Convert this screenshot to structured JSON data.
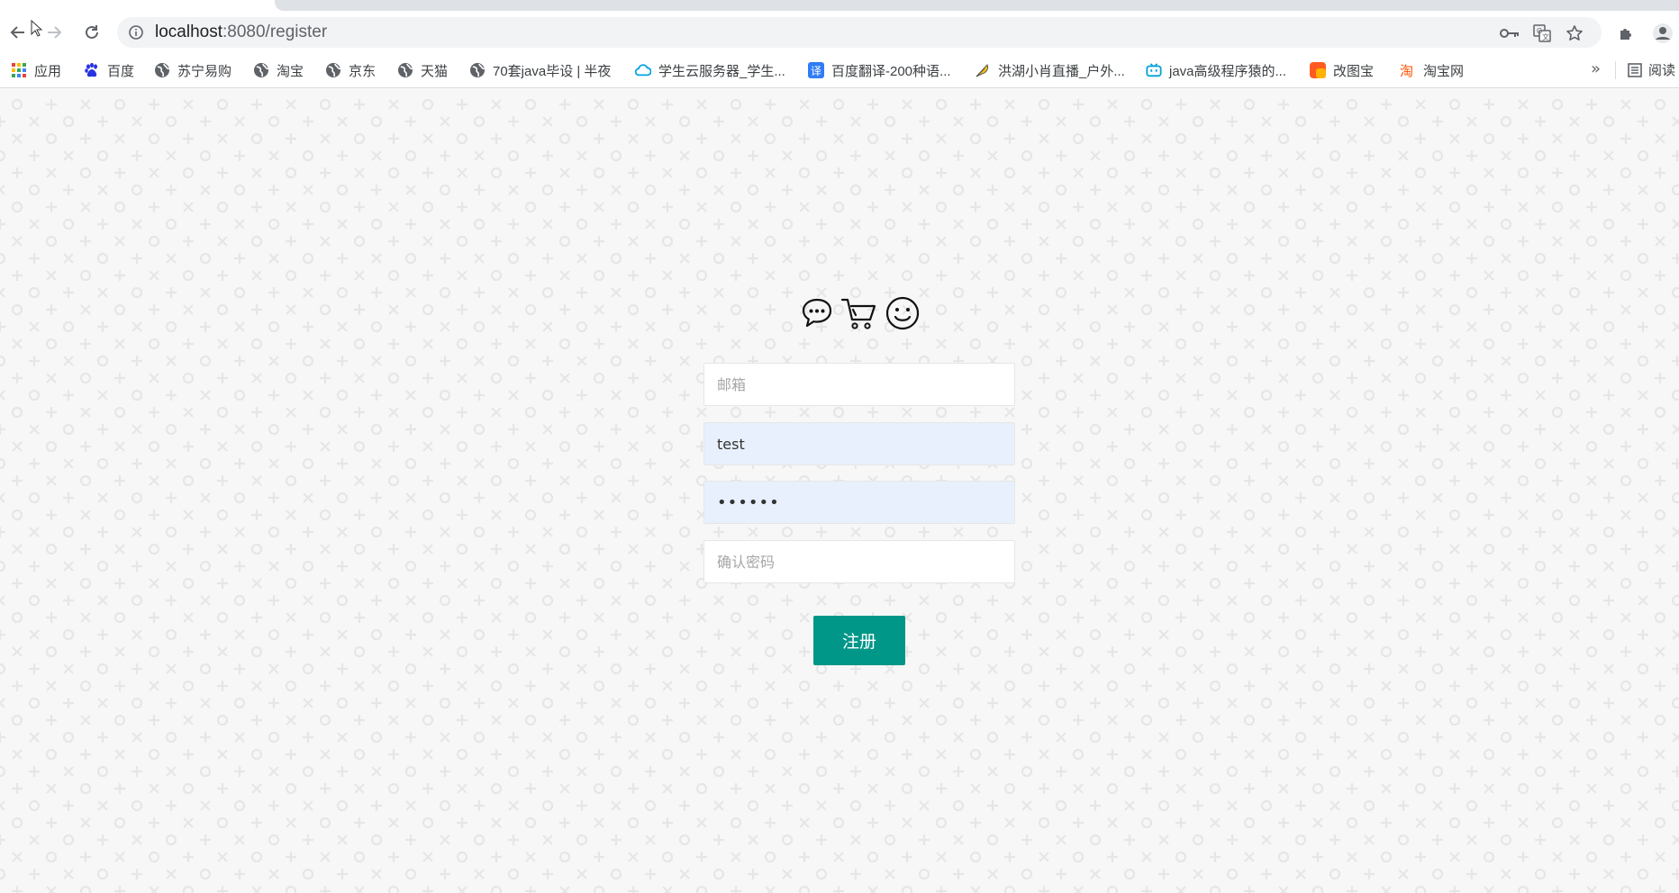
{
  "browser": {
    "url_host": "localhost",
    "url_path": ":8080/register",
    "bookmarks": [
      {
        "label": "应用",
        "icon": "apps-grid-icon"
      },
      {
        "label": "百度",
        "icon": "baidu-paw-icon"
      },
      {
        "label": "苏宁易购",
        "icon": "globe-icon"
      },
      {
        "label": "淘宝",
        "icon": "globe-icon"
      },
      {
        "label": "京东",
        "icon": "globe-icon"
      },
      {
        "label": "天猫",
        "icon": "globe-icon"
      },
      {
        "label": "70套java毕设 | 半夜",
        "icon": "globe-icon"
      },
      {
        "label": "学生云服务器_学生...",
        "icon": "cloud-icon"
      },
      {
        "label": "百度翻译-200种语...",
        "icon": "translate-icon"
      },
      {
        "label": "洪湖小肖直播_户外...",
        "icon": "feather-icon"
      },
      {
        "label": "java高级程序猿的...",
        "icon": "bilibili-icon"
      },
      {
        "label": "改图宝",
        "icon": "gaitubao-icon"
      },
      {
        "label": "淘宝网",
        "icon": "taobao-icon"
      }
    ],
    "more_label": "»",
    "reading_list_label": "阅读"
  },
  "form": {
    "email_placeholder": "邮箱",
    "username_value": "test",
    "password_value": "123456",
    "confirm_placeholder": "确认密码",
    "submit_label": "注册"
  },
  "colors": {
    "accent": "#009688",
    "autofill": "#e8f0fe",
    "page_bg": "#f7f7f7"
  }
}
